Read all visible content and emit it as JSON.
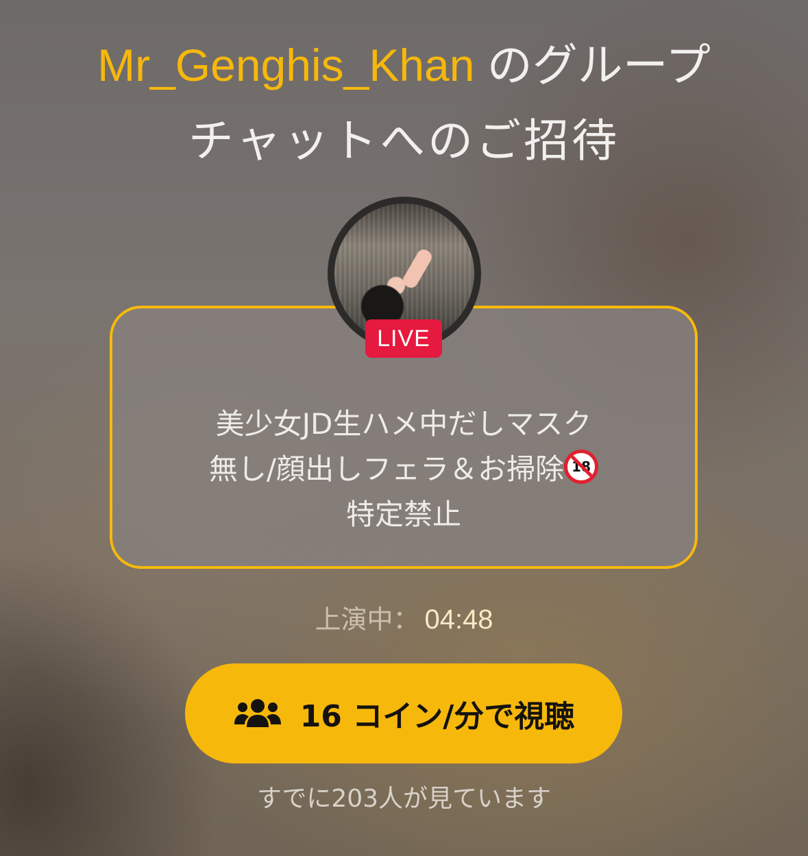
{
  "header": {
    "host_name": "Mr_Genghis_Khan",
    "title_part1": " のグループ",
    "title_line2": "チャットへのご招待"
  },
  "stream": {
    "badge": "LIVE",
    "title_line1": "美少女JD生ハメ中だしマスク",
    "title_line2": "無し/顔出しフェラ＆お掃除",
    "title_line3": "特定禁止",
    "age_badge": "18",
    "status_label": "上演中：",
    "elapsed": "04:48"
  },
  "actions": {
    "watch_label": "16 コイン/分で視聴"
  },
  "footer": {
    "viewers_text": "すでに203人が見ています"
  },
  "colors": {
    "accent": "#f7b80c",
    "live": "#e6193e"
  },
  "icons": {
    "watch_button": "group-users-icon",
    "age_restriction": "no-under-18-icon"
  }
}
